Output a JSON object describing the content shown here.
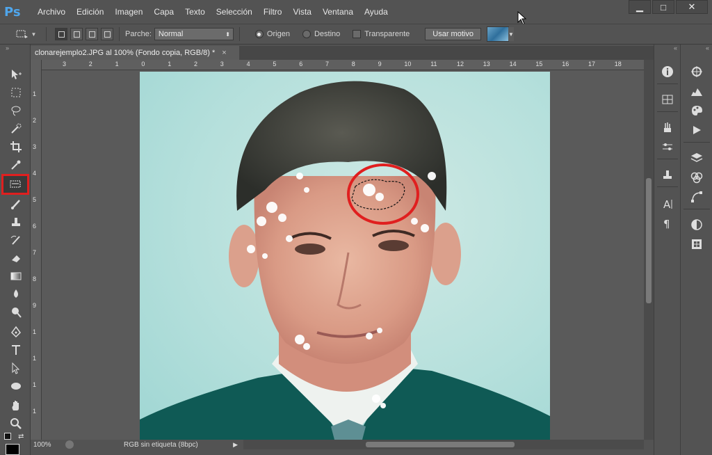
{
  "app": {
    "logo": "Ps"
  },
  "menu": [
    "Archivo",
    "Edición",
    "Imagen",
    "Capa",
    "Texto",
    "Selección",
    "Filtro",
    "Vista",
    "Ventana",
    "Ayuda"
  ],
  "window": {
    "min": "▁",
    "max": "□",
    "close": "✕"
  },
  "options": {
    "patch_label": "Parche:",
    "patch_value": "Normal",
    "source_label": "Origen",
    "dest_label": "Destino",
    "transparent_label": "Transparente",
    "use_pattern_label": "Usar motivo",
    "source_selected": true
  },
  "document": {
    "tab_title": "clonarejemplo2.JPG al 100% (Fondo copia, RGB/8) *",
    "close": "×"
  },
  "ruler": {
    "top": [
      "3",
      "2",
      "1",
      "0",
      "1",
      "2",
      "3",
      "4",
      "5",
      "6",
      "7",
      "8",
      "9",
      "10",
      "11",
      "12",
      "13",
      "14",
      "15",
      "16",
      "17",
      "18"
    ],
    "left": [
      "1",
      "2",
      "3",
      "4",
      "5",
      "6",
      "7",
      "8",
      "9",
      "1",
      "1",
      "1",
      "1"
    ]
  },
  "status": {
    "zoom": "100%",
    "info": "RGB sin etiqueta (8bpc)"
  },
  "toolbar": {
    "tools": [
      "move-tool",
      "marquee-tool",
      "lasso-tool",
      "quick-selection-tool",
      "crop-tool",
      "eyedropper-tool",
      "patch-tool",
      "brush-tool",
      "clone-stamp-tool",
      "history-brush-tool",
      "eraser-tool",
      "gradient-tool",
      "blur-tool",
      "dodge-tool",
      "pen-tool",
      "type-tool",
      "path-selection-tool",
      "ellipse-tool",
      "hand-tool",
      "zoom-tool"
    ],
    "selected": "patch-tool"
  },
  "colors": {
    "highlight": "#e01f1f",
    "ps_blue": "#4fa6ec"
  }
}
